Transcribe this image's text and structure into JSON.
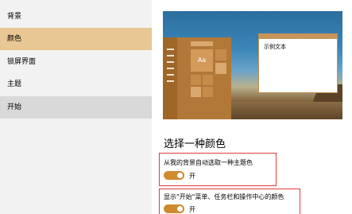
{
  "sidebar": {
    "items": [
      {
        "label": "背景"
      },
      {
        "label": "颜色"
      },
      {
        "label": "锁屏界面"
      },
      {
        "label": "主题"
      },
      {
        "label": "开始"
      }
    ]
  },
  "preview": {
    "tile_label": "Aa",
    "sample_text": "示例文本"
  },
  "colors": {
    "accent": "#cf8a2f",
    "selected_nav": "#e8c794",
    "highlight": "#e23b3b"
  },
  "section": {
    "title": "选择一种颜色"
  },
  "settings": [
    {
      "label": "从我的背景自动选取一种主题色",
      "state": "开",
      "on": true
    },
    {
      "label": "显示\"开始\"菜单、任务栏和操作中心的颜色",
      "state": "开",
      "on": true
    }
  ]
}
